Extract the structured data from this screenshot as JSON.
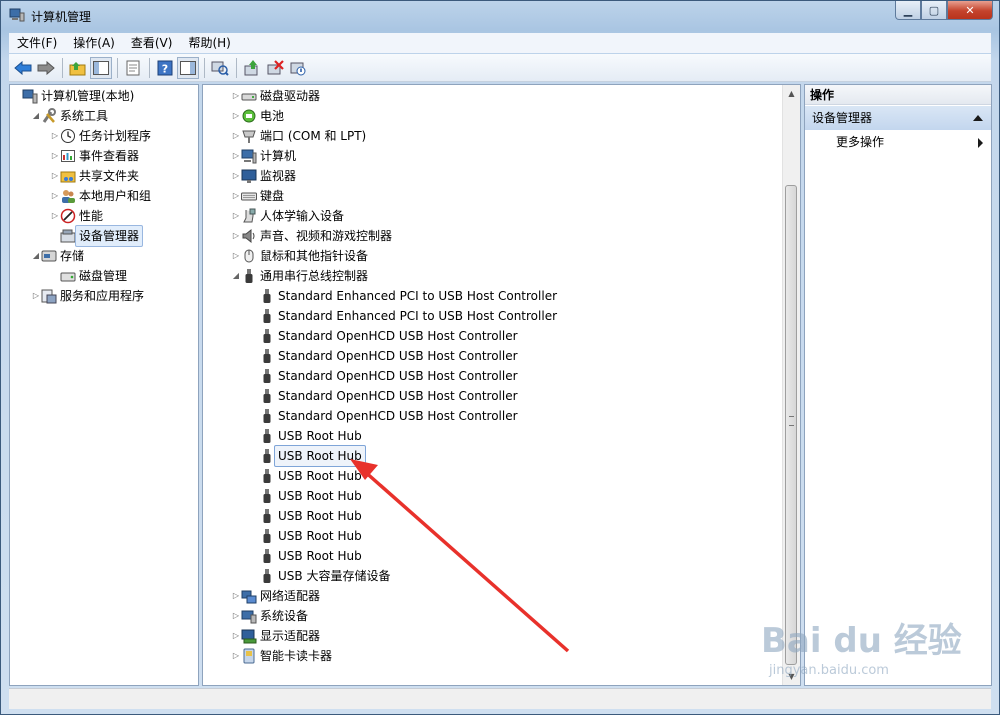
{
  "window": {
    "title": "计算机管理"
  },
  "menu": [
    "文件(F)",
    "操作(A)",
    "查看(V)",
    "帮助(H)"
  ],
  "left_tree": [
    {
      "label": "计算机管理(本地)",
      "arrow": "",
      "icon": "computer-management-icon"
    },
    {
      "label": "系统工具",
      "arrow": "▲",
      "icon": "system-tools-icon"
    },
    {
      "label": "任务计划程序",
      "arrow": "▷",
      "icon": "clock-icon"
    },
    {
      "label": "事件查看器",
      "arrow": "▷",
      "icon": "event-viewer-icon"
    },
    {
      "label": "共享文件夹",
      "arrow": "▷",
      "icon": "shared-folder-icon"
    },
    {
      "label": "本地用户和组",
      "arrow": "▷",
      "icon": "users-icon"
    },
    {
      "label": "性能",
      "arrow": "▷",
      "icon": "performance-icon"
    },
    {
      "label": "设备管理器",
      "arrow": "",
      "icon": "device-manager-icon",
      "selected": true
    },
    {
      "label": "存储",
      "arrow": "▲",
      "icon": "storage-icon"
    },
    {
      "label": "磁盘管理",
      "arrow": "",
      "icon": "disk-management-icon"
    },
    {
      "label": "服务和应用程序",
      "arrow": "▷",
      "icon": "services-icon"
    }
  ],
  "device_tree": [
    {
      "label": "磁盘驱动器",
      "arrow": "▷",
      "icon": "disk-drive-icon"
    },
    {
      "label": "电池",
      "arrow": "▷",
      "icon": "battery-icon"
    },
    {
      "label": "端口 (COM 和 LPT)",
      "arrow": "▷",
      "icon": "port-icon"
    },
    {
      "label": "计算机",
      "arrow": "▷",
      "icon": "computer-icon"
    },
    {
      "label": "监视器",
      "arrow": "▷",
      "icon": "monitor-icon"
    },
    {
      "label": "键盘",
      "arrow": "▷",
      "icon": "keyboard-icon"
    },
    {
      "label": "人体学输入设备",
      "arrow": "▷",
      "icon": "hid-icon"
    },
    {
      "label": "声音、视频和游戏控制器",
      "arrow": "▷",
      "icon": "speaker-icon"
    },
    {
      "label": "鼠标和其他指针设备",
      "arrow": "▷",
      "icon": "mouse-icon"
    },
    {
      "label": "通用串行总线控制器",
      "arrow": "▲",
      "icon": "usb-icon"
    },
    {
      "label": "Standard Enhanced PCI to USB Host Controller",
      "icon": "usb-icon",
      "child": true
    },
    {
      "label": "Standard Enhanced PCI to USB Host Controller",
      "icon": "usb-icon",
      "child": true
    },
    {
      "label": "Standard OpenHCD USB Host Controller",
      "icon": "usb-icon",
      "child": true
    },
    {
      "label": "Standard OpenHCD USB Host Controller",
      "icon": "usb-icon",
      "child": true
    },
    {
      "label": "Standard OpenHCD USB Host Controller",
      "icon": "usb-icon",
      "child": true
    },
    {
      "label": "Standard OpenHCD USB Host Controller",
      "icon": "usb-icon",
      "child": true
    },
    {
      "label": "Standard OpenHCD USB Host Controller",
      "icon": "usb-icon",
      "child": true
    },
    {
      "label": "USB Root Hub",
      "icon": "usb-icon",
      "child": true
    },
    {
      "label": "USB Root Hub",
      "icon": "usb-icon",
      "child": true,
      "selected": true
    },
    {
      "label": "USB Root Hub",
      "icon": "usb-icon",
      "child": true
    },
    {
      "label": "USB Root Hub",
      "icon": "usb-icon",
      "child": true
    },
    {
      "label": "USB Root Hub",
      "icon": "usb-icon",
      "child": true
    },
    {
      "label": "USB Root Hub",
      "icon": "usb-icon",
      "child": true
    },
    {
      "label": "USB Root Hub",
      "icon": "usb-icon",
      "child": true
    },
    {
      "label": "USB 大容量存储设备",
      "icon": "usb-icon",
      "child": true
    },
    {
      "label": "网络适配器",
      "arrow": "▷",
      "icon": "network-icon"
    },
    {
      "label": "系统设备",
      "arrow": "▷",
      "icon": "system-device-icon"
    },
    {
      "label": "显示适配器",
      "arrow": "▷",
      "icon": "display-adapter-icon"
    },
    {
      "label": "智能卡读卡器",
      "arrow": "▷",
      "icon": "card-reader-icon"
    }
  ],
  "actions": {
    "header": "操作",
    "section": "设备管理器",
    "more": "更多操作"
  },
  "watermark": {
    "main": "Bai du 经验",
    "sub": "jingyan.baidu.com"
  },
  "colors": {
    "annotation_arrow": "#e8312b",
    "selection": "#e1edfb"
  }
}
